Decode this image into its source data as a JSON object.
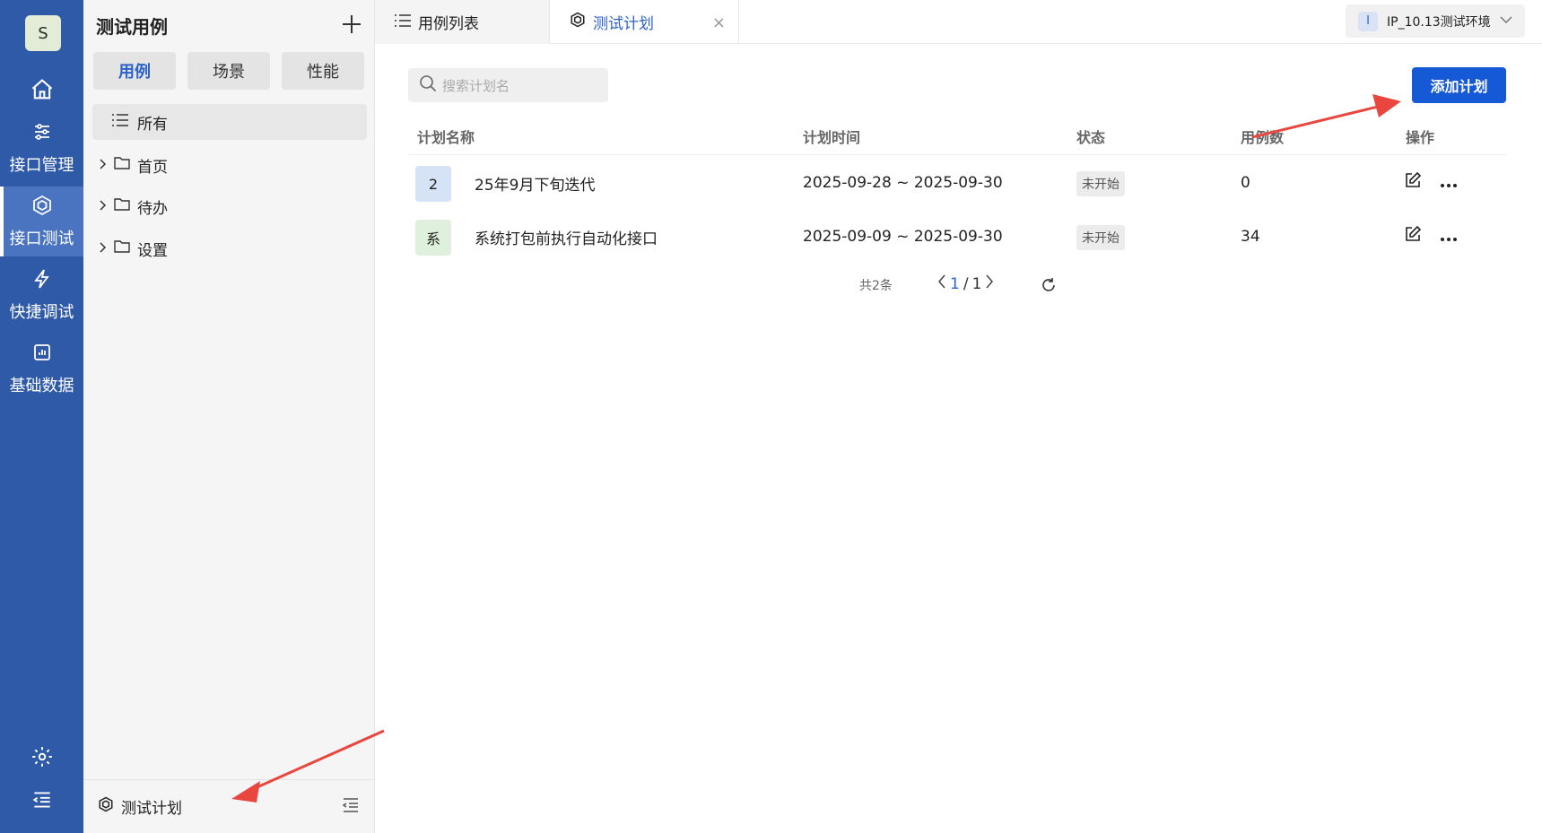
{
  "rail": {
    "avatar": "S",
    "items": [
      {
        "label": "接口管理",
        "icon": "sliders-icon"
      },
      {
        "label": "接口测试",
        "icon": "cube-icon"
      },
      {
        "label": "快捷调试",
        "icon": "lightning-icon"
      },
      {
        "label": "基础数据",
        "icon": "chart-icon"
      }
    ],
    "active_index": 1
  },
  "sidebar": {
    "title": "测试用例",
    "segments": [
      "用例",
      "场景",
      "性能"
    ],
    "active_segment": 0,
    "tree_all": "所有",
    "folders": [
      "首页",
      "待办",
      "设置"
    ],
    "footer_label": "测试计划"
  },
  "tabs": [
    {
      "label": "用例列表",
      "icon": "list-icon"
    },
    {
      "label": "测试计划",
      "icon": "cube-icon",
      "active": true
    }
  ],
  "env": {
    "badge": "I",
    "label": "IP_10.13测试环境"
  },
  "main": {
    "search_placeholder": "搜索计划名",
    "add_button": "添加计划",
    "columns": [
      "计划名称",
      "计划时间",
      "状态",
      "用例数",
      "操作"
    ],
    "rows": [
      {
        "badge": "2",
        "badge_color": "#d6e2f6",
        "name": "25年9月下旬迭代",
        "time": "2025-09-28 ~ 2025-09-30",
        "status": "未开始",
        "count": "0"
      },
      {
        "badge": "系",
        "badge_color": "#dff0dc",
        "name": "系统打包前执行自动化接口",
        "time": "2025-09-09 ~ 2025-09-30",
        "status": "未开始",
        "count": "34"
      }
    ],
    "pager": {
      "total": "共2条",
      "current": "1",
      "sep": "/",
      "pages": "1"
    }
  },
  "colors": {
    "rail": "#2f5aa8",
    "accent": "#1559d6",
    "arrow": "#e8463f"
  }
}
